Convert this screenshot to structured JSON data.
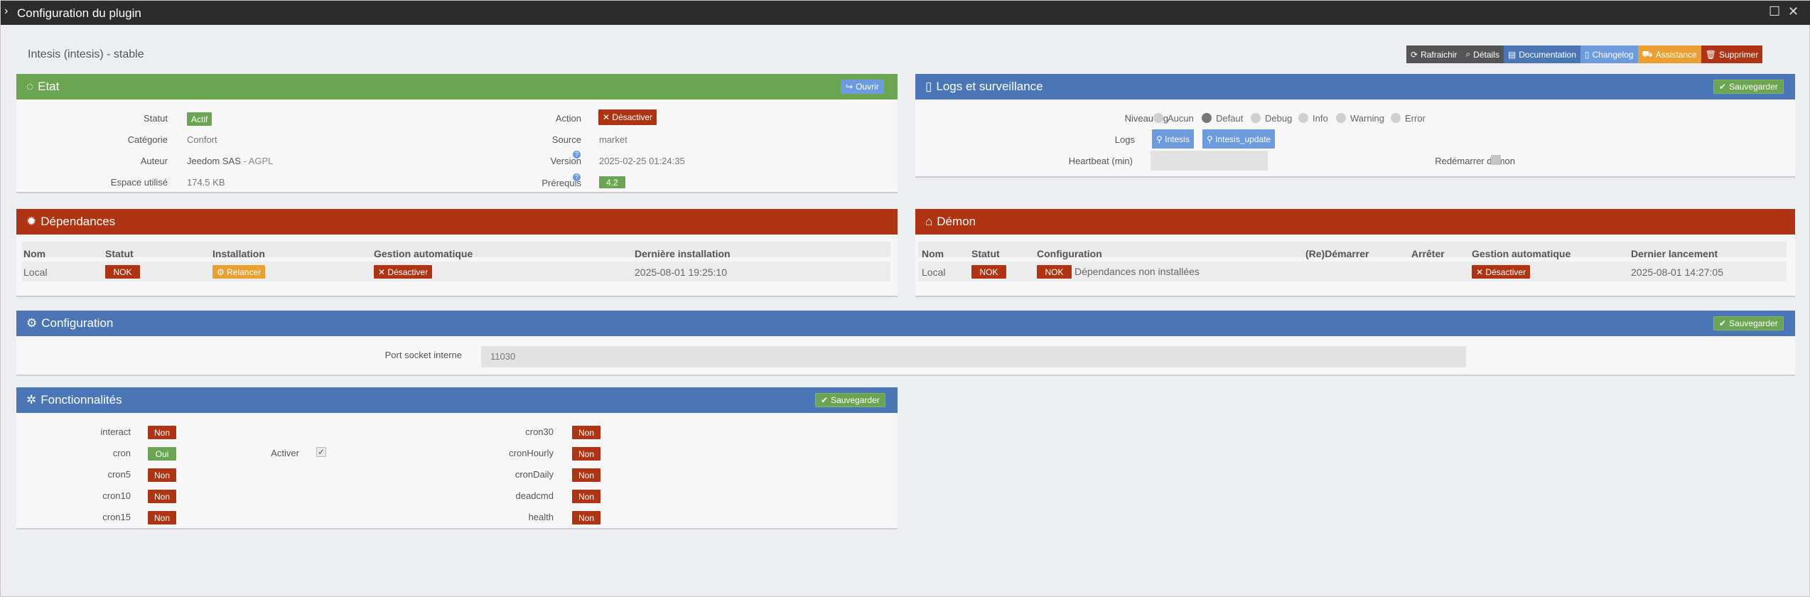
{
  "window": {
    "title": "Configuration du plugin"
  },
  "plugin_title": "Intesis (intesis) - stable",
  "toolbar": {
    "refresh": "Rafraichir",
    "details": "Détails",
    "documentation": "Documentation",
    "changelog": "Changelog",
    "assistance": "Assistance",
    "delete": "Supprimer"
  },
  "etat": {
    "title": "Etat",
    "open_btn": "Ouvrir",
    "statut_label": "Statut",
    "statut_value": "Actif",
    "categorie_label": "Catégorie",
    "categorie_value": "Confort",
    "auteur_label": "Auteur",
    "auteur_value": "Jeedom SAS",
    "licence_value": " - AGPL",
    "espace_label": "Espace utilisé",
    "espace_value": "174.5 KB",
    "action_label": "Action",
    "action_btn": "Désactiver",
    "source_label": "Source",
    "source_value": "market",
    "version_label": "Version",
    "version_value": "2025-02-25 01:24:35",
    "prerequis_label": "Prérequis",
    "prerequis_value": "4.2"
  },
  "logs": {
    "title": "Logs et surveillance",
    "save_btn": "Sauvegarder",
    "niveau_label": "Niveau log",
    "levels": [
      "Aucun",
      "Defaut",
      "Debug",
      "Info",
      "Warning",
      "Error"
    ],
    "selected_level": "Defaut",
    "logs_label": "Logs",
    "log_files": [
      "Intesis",
      "Intesis_update"
    ],
    "heartbeat_label": "Heartbeat (min)",
    "restart_label": "Redémarrer démon"
  },
  "dependances": {
    "title": "Dépendances",
    "columns": [
      "Nom",
      "Statut",
      "Installation",
      "Gestion automatique",
      "Dernière installation"
    ],
    "row": {
      "nom": "Local",
      "statut": "NOK",
      "installation": "Relancer",
      "gestion": "Désactiver",
      "derniere": "2025-08-01 19:25:10"
    }
  },
  "demon": {
    "title": "Démon",
    "columns": [
      "Nom",
      "Statut",
      "Configuration",
      "(Re)Démarrer",
      "Arrêter",
      "Gestion automatique",
      "Dernier lancement"
    ],
    "row": {
      "nom": "Local",
      "statut": "NOK",
      "config_badge": "NOK",
      "config_text": "Dépendances non installées",
      "gestion": "Désactiver",
      "dernier": "2025-08-01 14:27:05"
    }
  },
  "configuration": {
    "title": "Configuration",
    "save_btn": "Sauvegarder",
    "port_label": "Port socket interne",
    "port_value": "11030"
  },
  "fonctionnalites": {
    "title": "Fonctionnalités",
    "save_btn": "Sauvegarder",
    "left": [
      {
        "name": "interact",
        "value": "Non"
      },
      {
        "name": "cron",
        "value": "Oui"
      },
      {
        "name": "cron5",
        "value": "Non"
      },
      {
        "name": "cron10",
        "value": "Non"
      },
      {
        "name": "cron15",
        "value": "Non"
      }
    ],
    "activer_label": "Activer",
    "right": [
      {
        "name": "cron30",
        "value": "Non"
      },
      {
        "name": "cronHourly",
        "value": "Non"
      },
      {
        "name": "cronDaily",
        "value": "Non"
      },
      {
        "name": "deadcmd",
        "value": "Non"
      },
      {
        "name": "health",
        "value": "Non"
      }
    ]
  },
  "colors": {
    "green": "#6ba552",
    "blue": "#4a76b8",
    "red": "#ae3414",
    "orange": "#e9a030",
    "light_blue": "#6d9be0"
  }
}
